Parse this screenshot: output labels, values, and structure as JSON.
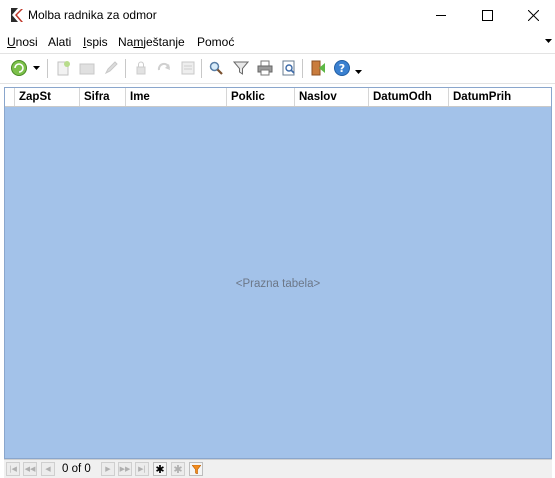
{
  "window": {
    "title": "Molba radnika za odmor"
  },
  "menu": {
    "items": [
      {
        "label": "Unosi",
        "underline": "U"
      },
      {
        "label": "Alati",
        "underline": ""
      },
      {
        "label": "Ispis",
        "underline": "I"
      },
      {
        "label": "Namještanje",
        "underline": "m"
      },
      {
        "label": "Pomoć",
        "underline": ""
      }
    ]
  },
  "toolbar": {
    "icons": [
      "refresh-dropdown-icon",
      "new-record-icon",
      "open-folder-icon",
      "edit-icon",
      "lock-icon",
      "undo-icon",
      "form-icon",
      "search-icon",
      "filter-icon",
      "print-icon",
      "print-preview-icon",
      "exit-icon",
      "help-icon"
    ]
  },
  "grid": {
    "columns": [
      "ZapSt",
      "Sifra",
      "Ime",
      "Poklic",
      "Naslov",
      "DatumOdh",
      "DatumPrih"
    ],
    "empty_message": "<Prazna tabela>"
  },
  "navigator": {
    "record_count": "0 of 0"
  },
  "colors": {
    "grid_background": "#a3c2e9",
    "empty_text": "#6c7788"
  }
}
